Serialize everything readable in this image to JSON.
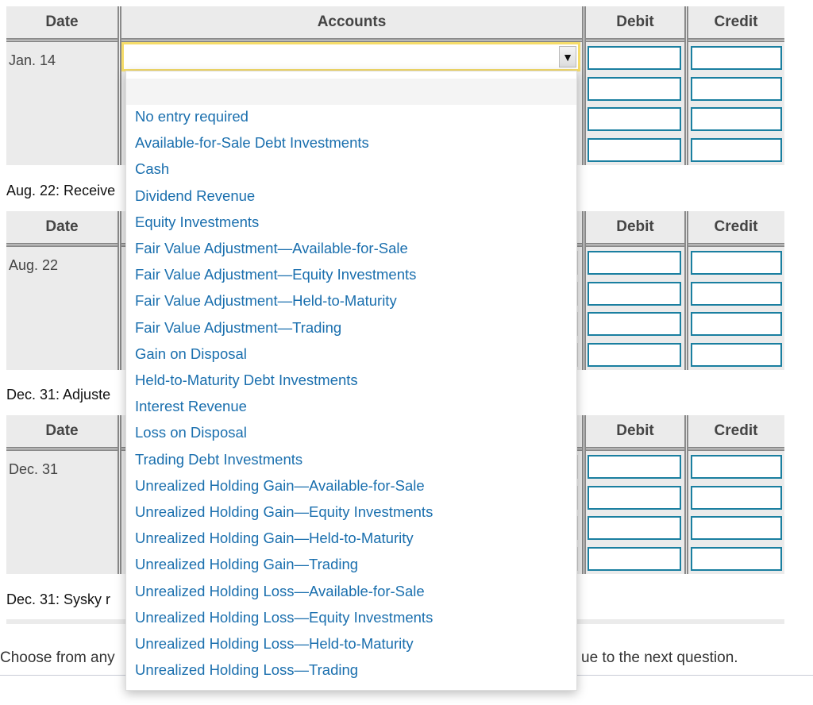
{
  "headers": {
    "date": "Date",
    "accounts": "Accounts",
    "debit": "Debit",
    "credit": "Credit"
  },
  "tables": [
    {
      "date": "Jan. 14"
    },
    {
      "date": "Aug. 22"
    },
    {
      "date": "Dec. 31"
    }
  ],
  "descriptions": [
    "Aug. 22: Receive",
    "Dec. 31: Adjuste",
    "Dec. 31: Sysky r"
  ],
  "footer": {
    "left": "Choose from any",
    "right": "ue to the next question."
  },
  "dropdown": {
    "selected": "",
    "arrow": "▼",
    "options": [
      "No entry required",
      "Available-for-Sale Debt Investments",
      "Cash",
      "Dividend Revenue",
      "Equity Investments",
      "Fair Value Adjustment—Available-for-Sale",
      "Fair Value Adjustment—Equity Investments",
      "Fair Value Adjustment—Held-to-Maturity",
      "Fair Value Adjustment—Trading",
      "Gain on Disposal",
      "Held-to-Maturity Debt Investments",
      "Interest Revenue",
      "Loss on Disposal",
      "Trading Debt Investments",
      "Unrealized Holding Gain—Available-for-Sale",
      "Unrealized Holding Gain—Equity Investments",
      "Unrealized Holding Gain—Held-to-Maturity",
      "Unrealized Holding Gain—Trading",
      "Unrealized Holding Loss—Available-for-Sale",
      "Unrealized Holding Loss—Equity Investments",
      "Unrealized Holding Loss—Held-to-Maturity",
      "Unrealized Holding Loss—Trading"
    ]
  },
  "colors": {
    "link": "#1a6fae",
    "input_border": "#1a7fa0",
    "focus": "#f5dc6a"
  }
}
